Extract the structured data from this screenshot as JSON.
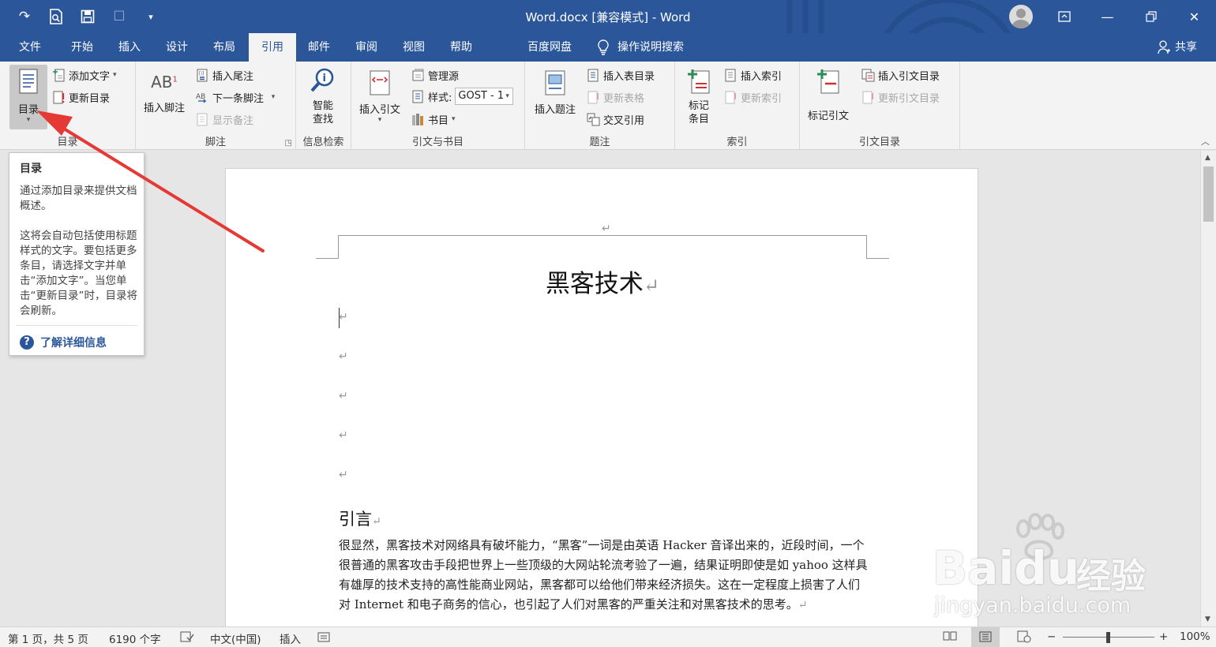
{
  "titlebar": {
    "title": "Word.docx [兼容模式]  -  Word",
    "qat": [
      "redo-icon",
      "print-preview-icon",
      "save-icon",
      "touch-mode-icon",
      "customize-qat-icon"
    ],
    "brand_color": "#2b579a"
  },
  "tabs": {
    "file": "文件",
    "home": "开始",
    "insert": "插入",
    "design": "设计",
    "layout": "布局",
    "references": "引用",
    "mailings": "邮件",
    "review": "审阅",
    "view": "视图",
    "help": "帮助",
    "baidu": "百度网盘",
    "tellme": "操作说明搜索",
    "share": "共享",
    "active": "引用"
  },
  "ribbon": {
    "toc": {
      "label": "目录",
      "add_text": "添加文字",
      "update": "更新目录",
      "group": "目录"
    },
    "footnotes": {
      "insert_footnote": "插入脚注",
      "insert_endnote": "插入尾注",
      "next_footnote": "下一条脚注",
      "show_notes": "显示备注",
      "group": "脚注"
    },
    "research": {
      "smart_lookup_1": "智能",
      "smart_lookup_2": "查找",
      "group": "信息检索"
    },
    "citations": {
      "insert_citation": "插入引文",
      "manage_sources": "管理源",
      "style_label": "样式:",
      "style_value": "GOST - 1",
      "bibliography": "书目",
      "group": "引文与书目"
    },
    "captions": {
      "insert_caption": "插入题注",
      "insert_table_of_figures": "插入表目录",
      "update_table": "更新表格",
      "cross_reference": "交叉引用",
      "group": "题注"
    },
    "index": {
      "mark_entry_1": "标记",
      "mark_entry_2": "条目",
      "insert_index": "插入索引",
      "update_index": "更新索引",
      "group": "索引"
    },
    "authorities": {
      "mark_citation": "标记引文",
      "insert_toa": "插入引文目录",
      "update_toa": "更新引文目录",
      "group": "引文目录"
    }
  },
  "tooltip": {
    "title": "目录",
    "p1": "通过添加目录来提供文档概述。",
    "p2": "这将会自动包括使用标题样式的文字。要包括更多条目，请选择文字并单击“添加文字”。当您单击“更新目录”时，目录将会刷新。",
    "link": "了解详细信息"
  },
  "document": {
    "pilcrow": "↵",
    "title": "黑客技术",
    "heading": "引言",
    "body": "很显然，黑客技术对网络具有破坏能力，“黑客”一词是由英语 Hacker 音译出来的，近段时间，一个很普通的黑客攻击手段把世界上一些顶级的大网站轮流考验了一遍，结果证明即使是如 yahoo 这样具有雄厚的技术支持的高性能商业网站，黑客都可以给他们带来经济损失。这在一定程度上损害了人们对 Internet 和电子商务的信心，也引起了人们对黑客的严重关注和对黑客技术的思考。"
  },
  "statusbar": {
    "page": "第 1 页，共 5 页",
    "words": "6190 个字",
    "language": "中文(中国)",
    "mode": "插入",
    "zoom": "100%",
    "zoom_minus": "−",
    "zoom_plus": "+"
  },
  "watermark": {
    "main": "Baidu",
    "cn": "经验",
    "url": "jingyan.baidu.com"
  },
  "annotation_color": "#e53935"
}
